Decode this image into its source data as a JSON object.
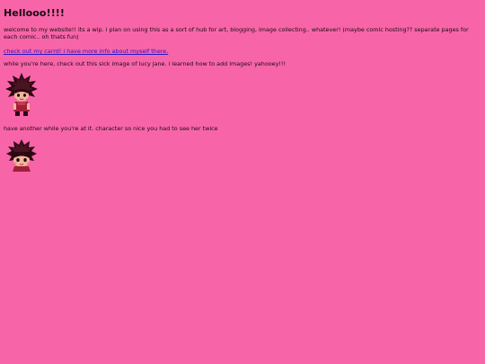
{
  "page": {
    "title": "Hellooo!!!!",
    "intro": "welcome to my website!! its a wip. i plan on using this as a sort of hub for art, blogging, image collecting.. whatever! (maybe comic hosting?? separate pages for each comic.. oh thats fun)",
    "link_text": "check out my carrd! i have more info about myself there.",
    "image_note": "while you're here, check out this sick image of lucy jane. i learned how to add images! yahooey!!!",
    "second_note": "have another while you're at it. character so nice you had to see her twice"
  },
  "colors": {
    "background": "#f765a8",
    "link": "#2a12c8",
    "text": "#1a0a12"
  }
}
